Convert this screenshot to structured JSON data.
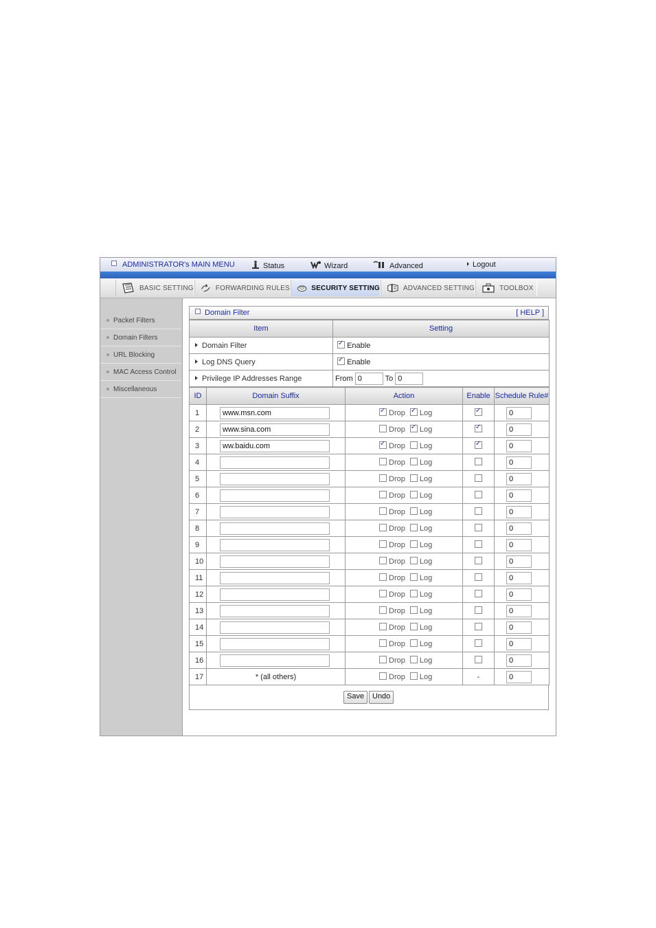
{
  "topmenu": {
    "title": "ADMINISTRATOR's MAIN MENU",
    "status": "Status",
    "wizard": "Wizard",
    "advanced": "Advanced",
    "logout": "Logout"
  },
  "tabs": [
    {
      "label": "BASIC SETTING",
      "icon": "basic-setting-icon"
    },
    {
      "label": "FORWARDING RULES",
      "icon": "forwarding-rules-icon"
    },
    {
      "label": "SECURITY SETTING",
      "icon": "security-setting-icon",
      "active": true
    },
    {
      "label": "ADVANCED SETTING",
      "icon": "advanced-setting-icon"
    },
    {
      "label": "TOOLBOX",
      "icon": "toolbox-icon"
    }
  ],
  "sidebar": {
    "items": [
      {
        "label": "Packet Filters"
      },
      {
        "label": "Domain Filters"
      },
      {
        "label": "URL Blocking"
      },
      {
        "label": "MAC Access Control"
      },
      {
        "label": "Miscellaneous"
      }
    ]
  },
  "panel": {
    "title": "Domain Filter",
    "help": "[ HELP ]",
    "col_item": "Item",
    "col_setting": "Setting",
    "domain_filter": {
      "label": "Domain Filter",
      "enable_label": "Enable",
      "checked": true
    },
    "log_dns": {
      "label": "Log DNS Query",
      "enable_label": "Enable",
      "checked": true
    },
    "privilege": {
      "label": "Privilege IP Addresses Range",
      "from_label": "From",
      "from_value": "0",
      "to_label": "To",
      "to_value": "0"
    }
  },
  "rules": {
    "headers": {
      "id": "ID",
      "suffix": "Domain Suffix",
      "action": "Action",
      "enable": "Enable",
      "schedule": "Schedule Rule#"
    },
    "drop_label": "Drop",
    "log_label": "Log",
    "rows": [
      {
        "id": "1",
        "suffix": "www.msn.com",
        "drop": true,
        "log": true,
        "enable": true,
        "schedule": "0"
      },
      {
        "id": "2",
        "suffix": "www.sina.com",
        "drop": false,
        "log": true,
        "enable": true,
        "schedule": "0"
      },
      {
        "id": "3",
        "suffix": "ww.baidu.com",
        "drop": true,
        "log": false,
        "enable": true,
        "schedule": "0"
      },
      {
        "id": "4",
        "suffix": "",
        "drop": false,
        "log": false,
        "enable": false,
        "schedule": "0"
      },
      {
        "id": "5",
        "suffix": "",
        "drop": false,
        "log": false,
        "enable": false,
        "schedule": "0"
      },
      {
        "id": "6",
        "suffix": "",
        "drop": false,
        "log": false,
        "enable": false,
        "schedule": "0"
      },
      {
        "id": "7",
        "suffix": "",
        "drop": false,
        "log": false,
        "enable": false,
        "schedule": "0"
      },
      {
        "id": "8",
        "suffix": "",
        "drop": false,
        "log": false,
        "enable": false,
        "schedule": "0"
      },
      {
        "id": "9",
        "suffix": "",
        "drop": false,
        "log": false,
        "enable": false,
        "schedule": "0"
      },
      {
        "id": "10",
        "suffix": "",
        "drop": false,
        "log": false,
        "enable": false,
        "schedule": "0"
      },
      {
        "id": "11",
        "suffix": "",
        "drop": false,
        "log": false,
        "enable": false,
        "schedule": "0"
      },
      {
        "id": "12",
        "suffix": "",
        "drop": false,
        "log": false,
        "enable": false,
        "schedule": "0"
      },
      {
        "id": "13",
        "suffix": "",
        "drop": false,
        "log": false,
        "enable": false,
        "schedule": "0"
      },
      {
        "id": "14",
        "suffix": "",
        "drop": false,
        "log": false,
        "enable": false,
        "schedule": "0"
      },
      {
        "id": "15",
        "suffix": "",
        "drop": false,
        "log": false,
        "enable": false,
        "schedule": "0"
      },
      {
        "id": "16",
        "suffix": "",
        "drop": false,
        "log": false,
        "enable": false,
        "schedule": "0"
      }
    ],
    "last_row": {
      "id": "17",
      "label": "* (all others)",
      "drop": false,
      "log": false,
      "enable_text": "-",
      "schedule": "0"
    }
  },
  "buttons": {
    "save": "Save",
    "undo": "Undo"
  }
}
